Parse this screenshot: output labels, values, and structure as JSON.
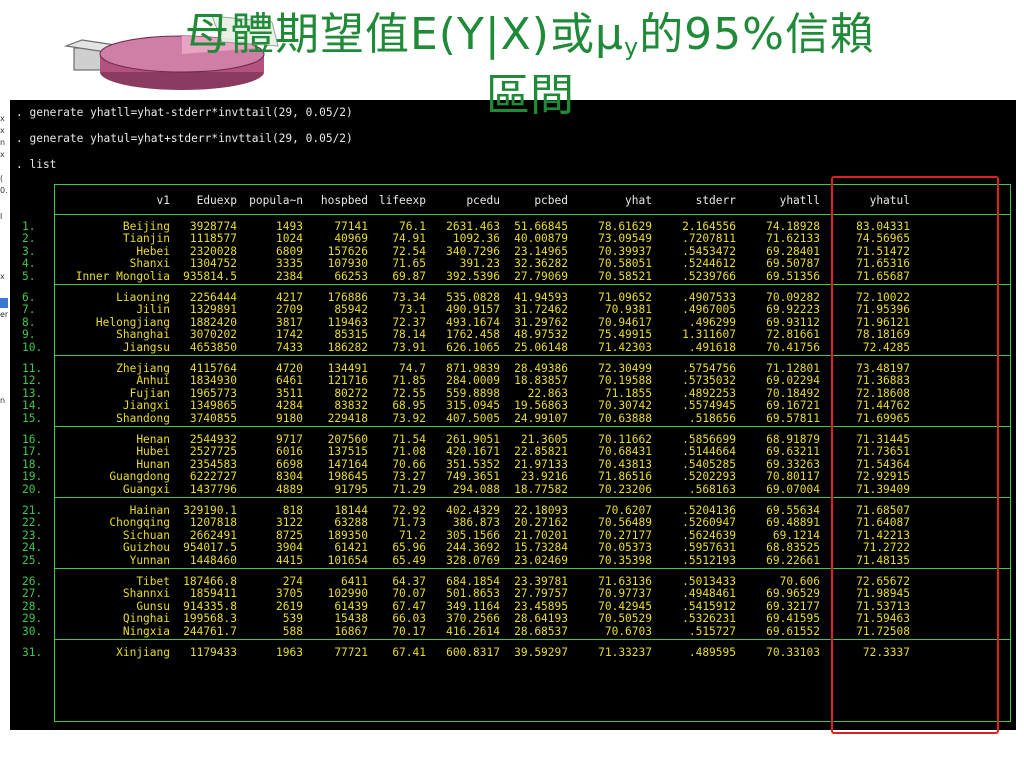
{
  "slide": {
    "title_line1_a": "母體期望值E(Y|X)或μ",
    "title_line1_sub": "y",
    "title_line1_b": "的95%信賴",
    "title_line2": "區間"
  },
  "colors": {
    "title": "#1f8a37",
    "console_bg": "#000000",
    "command_text": "#e8e8e8",
    "table_values": "#e9dc2a",
    "table_lines": "#3cc94b",
    "highlight_box": "#e0201c"
  },
  "console": {
    "commands": [
      ". generate yhatll=yhat-stderr*invttail(29, 0.05/2)",
      ". generate yhatul=yhat+stderr*invttail(29, 0.05/2)",
      ". list"
    ],
    "columns": [
      "v1",
      "Eduexp",
      "popula~n",
      "hospbed",
      "lifeexp",
      "pcedu",
      "pcbed",
      "yhat",
      "stderr",
      "yhatll",
      "yhatul"
    ],
    "rows": [
      {
        "idx": "1.",
        "v": [
          "Beijing",
          "3928774",
          "1493",
          "77141",
          "76.1",
          "2631.463",
          "51.66845",
          "78.61629",
          "2.164556",
          "74.18928",
          "83.04331"
        ]
      },
      {
        "idx": "2.",
        "v": [
          "Tianjin",
          "1118577",
          "1024",
          "40969",
          "74.91",
          "1092.36",
          "40.00879",
          "73.09549",
          ".7207811",
          "71.62133",
          "74.56965"
        ]
      },
      {
        "idx": "3.",
        "v": [
          "Hebei",
          "2320028",
          "6809",
          "157626",
          "72.54",
          "340.7296",
          "23.14965",
          "70.39937",
          ".5453472",
          "69.28401",
          "71.51472"
        ]
      },
      {
        "idx": "4.",
        "v": [
          "Shanxi",
          "1304752",
          "3335",
          "107930",
          "71.65",
          "391.23",
          "32.36282",
          "70.58051",
          ".5244612",
          "69.50787",
          "71.65316"
        ]
      },
      {
        "idx": "5.",
        "v": [
          "Inner Mongolia",
          "935814.5",
          "2384",
          "66253",
          "69.87",
          "392.5396",
          "27.79069",
          "70.58521",
          ".5239766",
          "69.51356",
          "71.65687"
        ]
      },
      {
        "idx": "6.",
        "v": [
          "Liaoning",
          "2256444",
          "4217",
          "176886",
          "73.34",
          "535.0828",
          "41.94593",
          "71.09652",
          ".4907533",
          "70.09282",
          "72.10022"
        ]
      },
      {
        "idx": "7.",
        "v": [
          "Jilin",
          "1329891",
          "2709",
          "85942",
          "73.1",
          "490.9157",
          "31.72462",
          "70.9381",
          ".4967005",
          "69.92223",
          "71.95396"
        ]
      },
      {
        "idx": "8.",
        "v": [
          "Helongjiang",
          "1882420",
          "3817",
          "119463",
          "72.37",
          "493.1674",
          "31.29762",
          "70.94617",
          ".496299",
          "69.93112",
          "71.96121"
        ]
      },
      {
        "idx": "9.",
        "v": [
          "Shanghai",
          "3070202",
          "1742",
          "85315",
          "78.14",
          "1762.458",
          "48.97532",
          "75.49915",
          "1.311607",
          "72.81661",
          "78.18169"
        ]
      },
      {
        "idx": "10.",
        "v": [
          "Jiangsu",
          "4653850",
          "7433",
          "186282",
          "73.91",
          "626.1065",
          "25.06148",
          "71.42303",
          ".491618",
          "70.41756",
          "72.4285"
        ]
      },
      {
        "idx": "11.",
        "v": [
          "Zhejiang",
          "4115764",
          "4720",
          "134491",
          "74.7",
          "871.9839",
          "28.49386",
          "72.30499",
          ".5754756",
          "71.12801",
          "73.48197"
        ]
      },
      {
        "idx": "12.",
        "v": [
          "Anhui",
          "1834930",
          "6461",
          "121716",
          "71.85",
          "284.0009",
          "18.83857",
          "70.19588",
          ".5735032",
          "69.02294",
          "71.36883"
        ]
      },
      {
        "idx": "13.",
        "v": [
          "Fujian",
          "1965773",
          "3511",
          "80272",
          "72.55",
          "559.8898",
          "22.863",
          "71.1855",
          ".4892253",
          "70.18492",
          "72.18608"
        ]
      },
      {
        "idx": "14.",
        "v": [
          "Jiangxi",
          "1349865",
          "4284",
          "83832",
          "68.95",
          "315.0945",
          "19.56863",
          "70.30742",
          ".5574945",
          "69.16721",
          "71.44762"
        ]
      },
      {
        "idx": "15.",
        "v": [
          "Shandong",
          "3740855",
          "9180",
          "229418",
          "73.92",
          "407.5005",
          "24.99107",
          "70.63888",
          ".518656",
          "69.57811",
          "71.69965"
        ]
      },
      {
        "idx": "16.",
        "v": [
          "Henan",
          "2544932",
          "9717",
          "207560",
          "71.54",
          "261.9051",
          "21.3605",
          "70.11662",
          ".5856699",
          "68.91879",
          "71.31445"
        ]
      },
      {
        "idx": "17.",
        "v": [
          "Hubei",
          "2527725",
          "6016",
          "137515",
          "71.08",
          "420.1671",
          "22.85821",
          "70.68431",
          ".5144664",
          "69.63211",
          "71.73651"
        ]
      },
      {
        "idx": "18.",
        "v": [
          "Hunan",
          "2354583",
          "6698",
          "147164",
          "70.66",
          "351.5352",
          "21.97133",
          "70.43813",
          ".5405285",
          "69.33263",
          "71.54364"
        ]
      },
      {
        "idx": "19.",
        "v": [
          "Guangdong",
          "6222727",
          "8304",
          "198645",
          "73.27",
          "749.3651",
          "23.9216",
          "71.86516",
          ".5202293",
          "70.80117",
          "72.92915"
        ]
      },
      {
        "idx": "20.",
        "v": [
          "Guangxi",
          "1437796",
          "4889",
          "91795",
          "71.29",
          "294.088",
          "18.77582",
          "70.23206",
          ".568163",
          "69.07004",
          "71.39409"
        ]
      },
      {
        "idx": "21.",
        "v": [
          "Hainan",
          "329190.1",
          "818",
          "18144",
          "72.92",
          "402.4329",
          "22.18093",
          "70.6207",
          ".5204136",
          "69.55634",
          "71.68507"
        ]
      },
      {
        "idx": "22.",
        "v": [
          "Chongqing",
          "1207818",
          "3122",
          "63288",
          "71.73",
          "386.873",
          "20.27162",
          "70.56489",
          ".5260947",
          "69.48891",
          "71.64087"
        ]
      },
      {
        "idx": "23.",
        "v": [
          "Sichuan",
          "2662491",
          "8725",
          "189350",
          "71.2",
          "305.1566",
          "21.70201",
          "70.27177",
          ".5624639",
          "69.1214",
          "71.42213"
        ]
      },
      {
        "idx": "24.",
        "v": [
          "Guizhou",
          "954017.5",
          "3904",
          "61421",
          "65.96",
          "244.3692",
          "15.73284",
          "70.05373",
          ".5957631",
          "68.83525",
          "71.2722"
        ]
      },
      {
        "idx": "25.",
        "v": [
          "Yunnan",
          "1448460",
          "4415",
          "101654",
          "65.49",
          "328.0769",
          "23.02469",
          "70.35398",
          ".5512193",
          "69.22661",
          "71.48135"
        ]
      },
      {
        "idx": "26.",
        "v": [
          "Tibet",
          "187466.8",
          "274",
          "6411",
          "64.37",
          "684.1854",
          "23.39781",
          "71.63136",
          ".5013433",
          "70.606",
          "72.65672"
        ]
      },
      {
        "idx": "27.",
        "v": [
          "Shannxi",
          "1859411",
          "3705",
          "102990",
          "70.07",
          "501.8653",
          "27.79757",
          "70.97737",
          ".4948461",
          "69.96529",
          "71.98945"
        ]
      },
      {
        "idx": "28.",
        "v": [
          "Gunsu",
          "914335.8",
          "2619",
          "61439",
          "67.47",
          "349.1164",
          "23.45895",
          "70.42945",
          ".5415912",
          "69.32177",
          "71.53713"
        ]
      },
      {
        "idx": "29.",
        "v": [
          "Qinghai",
          "199568.3",
          "539",
          "15438",
          "66.03",
          "370.2566",
          "28.64193",
          "70.50529",
          ".5326231",
          "69.41595",
          "71.59463"
        ]
      },
      {
        "idx": "30.",
        "v": [
          "Ningxia",
          "244761.7",
          "588",
          "16867",
          "70.17",
          "416.2614",
          "28.68537",
          "70.6703",
          ".515727",
          "69.61552",
          "71.72508"
        ]
      },
      {
        "idx": "31.",
        "v": [
          "Xinjiang",
          "1179433",
          "1963",
          "77721",
          "67.41",
          "600.8317",
          "39.59297",
          "71.33237",
          ".489595",
          "70.33103",
          "72.3337"
        ]
      }
    ]
  },
  "left_panel": {
    "glyphs": [
      "x",
      "x",
      "n",
      "x",
      "(",
      "0.",
      "I",
      "x",
      "er",
      "n"
    ]
  }
}
